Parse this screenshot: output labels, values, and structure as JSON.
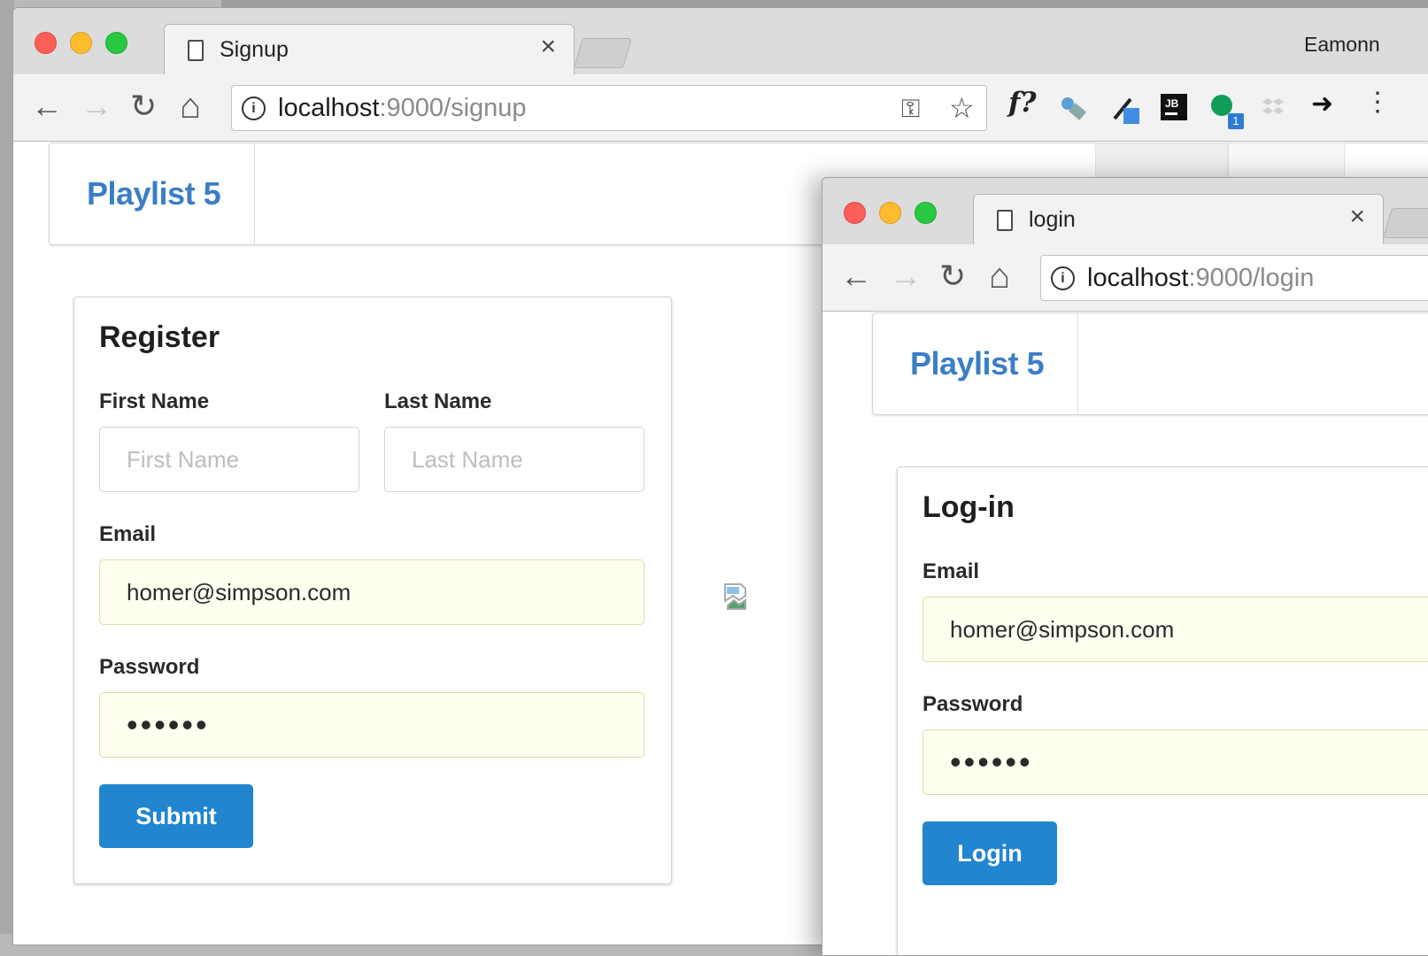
{
  "colors": {
    "accent": "#2185d0",
    "brand": "#3b7ec5",
    "autofill": "#fffff0"
  },
  "windows": {
    "signup": {
      "tab_title": "Signup",
      "profile_name": "Eamonn",
      "url_host": "localhost",
      "url_rest": ":9000/signup",
      "brand": "Playlist 5",
      "form": {
        "title": "Register",
        "first_name_label": "First Name",
        "first_name_placeholder": "First Name",
        "last_name_label": "Last Name",
        "last_name_placeholder": "Last Name",
        "email_label": "Email",
        "email_value": "homer@simpson.com",
        "password_label": "Password",
        "password_value": "••••••",
        "submit_label": "Submit"
      },
      "extensions": [
        "key-icon",
        "star-icon",
        "f-question-icon",
        "satellite-icon",
        "eyedropper-icon",
        "jetbrains-icon",
        "green-dot-icon",
        "dropbox-icon",
        "share-arrow-icon",
        "more-vert-icon"
      ],
      "extension_badge": "1"
    },
    "login": {
      "tab_title": "login",
      "url_host": "localhost",
      "url_rest": ":9000/login",
      "brand": "Playlist 5",
      "form": {
        "title": "Log-in",
        "email_label": "Email",
        "email_value": "homer@simpson.com",
        "password_label": "Password",
        "password_value": "••••••",
        "submit_label": "Login"
      }
    }
  },
  "glyphs": {
    "close": "×",
    "back": "←",
    "forward": "→",
    "reload": "↻",
    "home": "⌂",
    "info": "i",
    "star": "☆",
    "key": "⚿",
    "f_ext": "f?",
    "share": "➜",
    "more": "⋮"
  }
}
